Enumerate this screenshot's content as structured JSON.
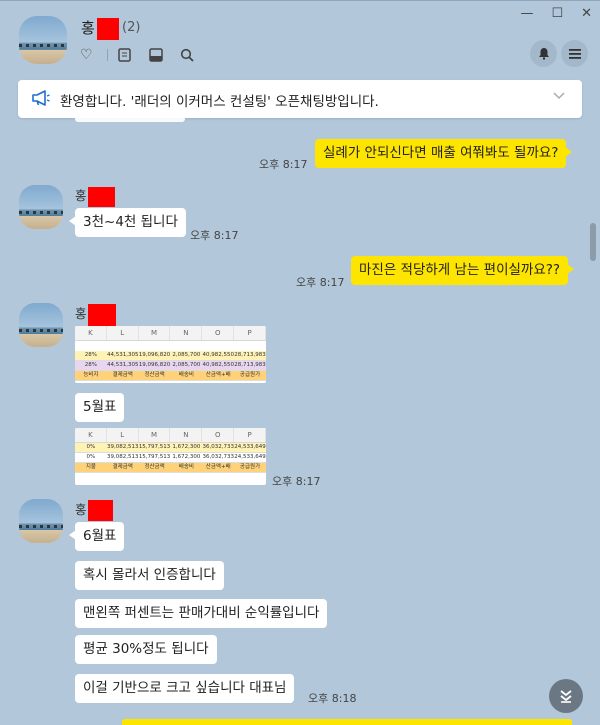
{
  "header": {
    "name_initial": "홍",
    "member_count": "(2)",
    "icons": [
      "heart-icon",
      "notes-icon",
      "album-icon",
      "search-icon"
    ],
    "window_controls": [
      "—",
      "☐",
      "✕"
    ]
  },
  "notice": {
    "text": "환영합니다. '래더의 이커머스 컨설팅' 오픈채팅방입니다."
  },
  "messages": {
    "m1": {
      "text": "실례가 안되신다면 매출 여쭤봐도 될까요?",
      "time": "오후 8:17"
    },
    "m2": {
      "sender": "홍",
      "text": "3천~4천 됩니다",
      "time": "오후 8:17"
    },
    "m3": {
      "text": "마진은 적당하게 남는 편이실까요??",
      "time": "오후 8:17"
    },
    "m4": {
      "sender": "홍",
      "sheet1": {
        "cols": [
          "K",
          "L",
          "M",
          "N",
          "O",
          "P"
        ],
        "rows": [
          [
            "28%",
            "44,531,305",
            "19,096,820",
            "2,085,700",
            "40,982,550",
            "28,713,983"
          ],
          [
            "28%",
            "44,531,305",
            "19,096,820",
            "2,085,700",
            "40,982,550",
            "28,713,983"
          ],
          [
            "능비지",
            "결제금액",
            "정산금액",
            "배송비",
            "산금액+배",
            "공급원가"
          ]
        ]
      },
      "label": "5월표",
      "sheet2": {
        "cols": [
          "K",
          "L",
          "M",
          "N",
          "O",
          "P"
        ],
        "rows": [
          [
            "0%",
            "39,082,513",
            "15,797,513",
            "1,672,300",
            "36,032,733",
            "24,533,649"
          ],
          [
            "0%",
            "39,082,513",
            "15,797,513",
            "1,672,300",
            "36,032,733",
            "24,533,649"
          ],
          [
            "지불",
            "결제금액",
            "정산금액",
            "배송비",
            "산금액+배",
            "공급원가"
          ]
        ]
      },
      "time": "오후 8:17"
    },
    "m5": {
      "sender": "홍",
      "lines": [
        "6월표",
        "혹시 몰라서 인증합니다",
        "맨왼쪽 퍼센트는 판매가대비 순익률입니다",
        "평균 30%정도 됩니다",
        "이걸 기반으로 크고 싶습니다 대표님"
      ],
      "time": "오후 8:18"
    }
  },
  "colors": {
    "background": "#b2c7d9",
    "my_bubble": "#fee500",
    "redaction": "#ff0000"
  }
}
